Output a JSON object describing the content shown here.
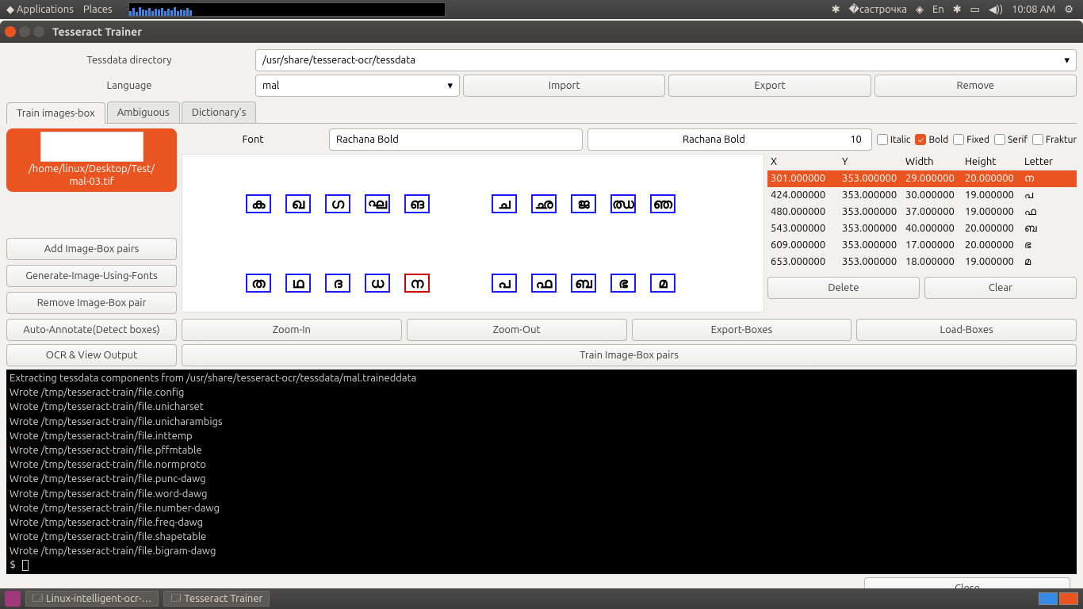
{
  "panel": {
    "applications": "Applications",
    "places": "Places",
    "lang": "En",
    "time": "10:08 AM"
  },
  "wm": {
    "title": "Tesseract Trainer"
  },
  "labels": {
    "tessdata": "Tessdata directory",
    "language": "Language",
    "font": "Font"
  },
  "fields": {
    "tessdata_path": "/usr/share/tesseract-ocr/tessdata",
    "language": "mal",
    "font_name": "Rachana Bold",
    "font_display": "Rachana Bold",
    "font_size": "10"
  },
  "buttons": {
    "import": "Import",
    "export": "Export",
    "remove": "Remove",
    "add_pair": "Add Image-Box pairs",
    "gen_font": "Generate-Image-Using-Fonts",
    "rem_pair": "Remove Image-Box pair",
    "auto_anno": "Auto-Annotate(Detect boxes)",
    "ocr_view": "OCR & View Output",
    "zoom_in": "Zoom-In",
    "zoom_out": "Zoom-Out",
    "export_boxes": "Export-Boxes",
    "load_boxes": "Load-Boxes",
    "train": "Train Image-Box pairs",
    "delete": "Delete",
    "clear": "Clear",
    "close": "Close"
  },
  "tabs": {
    "t1": "Train images-box",
    "t2": "Ambiguous",
    "t3": "Dictionary's"
  },
  "thumb": {
    "line1": "/home/linux/Desktop/Test/",
    "line2": "mal-03.tif"
  },
  "checks": {
    "italic": "Italic",
    "bold": "Bold",
    "fixed": "Fixed",
    "serif": "Serif",
    "fraktur": "Fraktur"
  },
  "table": {
    "headers": {
      "x": "X",
      "y": "Y",
      "w": "Width",
      "h": "Height",
      "l": "Letter"
    },
    "rows": [
      {
        "x": "301.000000",
        "y": "353.000000",
        "w": "29.000000",
        "h": "20.000000",
        "l": "ന"
      },
      {
        "x": "424.000000",
        "y": "353.000000",
        "w": "30.000000",
        "h": "19.000000",
        "l": "പ"
      },
      {
        "x": "480.000000",
        "y": "353.000000",
        "w": "37.000000",
        "h": "19.000000",
        "l": "ഫ"
      },
      {
        "x": "543.000000",
        "y": "353.000000",
        "w": "40.000000",
        "h": "20.000000",
        "l": "ബ"
      },
      {
        "x": "609.000000",
        "y": "353.000000",
        "w": "17.000000",
        "h": "20.000000",
        "l": "ഭ"
      },
      {
        "x": "653.000000",
        "y": "353.000000",
        "w": "18.000000",
        "h": "19.000000",
        "l": "മ"
      }
    ]
  },
  "glyphs": {
    "row1": [
      "ക",
      "ഖ",
      "ഗ",
      "ഘ",
      "ങ",
      "ച",
      "ഛ",
      "ജ",
      "ഝ",
      "ഞ"
    ],
    "row2": [
      "ത",
      "ഥ",
      "ദ",
      "ധ",
      "ന",
      "പ",
      "ഫ",
      "ബ",
      "ഭ",
      "മ"
    ]
  },
  "terminal_lines": [
    "Extracting tessdata components from /usr/share/tesseract-ocr/tessdata/mal.traineddata",
    "Wrote /tmp/tesseract-train/file.config",
    "Wrote /tmp/tesseract-train/file.unicharset",
    "Wrote /tmp/tesseract-train/file.unicharambigs",
    "Wrote /tmp/tesseract-train/file.inttemp",
    "Wrote /tmp/tesseract-train/file.pffmtable",
    "Wrote /tmp/tesseract-train/file.normproto",
    "Wrote /tmp/tesseract-train/file.punc-dawg",
    "Wrote /tmp/tesseract-train/file.word-dawg",
    "Wrote /tmp/tesseract-train/file.number-dawg",
    "Wrote /tmp/tesseract-train/file.freq-dawg",
    "Wrote /tmp/tesseract-train/file.shapetable",
    "Wrote /tmp/tesseract-train/file.bigram-dawg"
  ],
  "taskbar": {
    "t1": "Linux-intelligent-ocr-…",
    "t2": "Tesseract Trainer"
  }
}
